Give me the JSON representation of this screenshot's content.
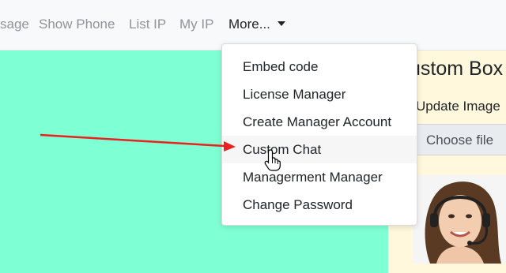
{
  "nav": {
    "items": [
      "sage",
      "Show Phone",
      "List IP",
      "My IP"
    ],
    "more_label": "More..."
  },
  "dropdown": {
    "items": [
      "Embed code",
      "License Manager",
      "Create Manager Account",
      "Custom Chat",
      "Managerment Manager",
      "Change Password"
    ],
    "hovered_item": "Custom Chat"
  },
  "panel": {
    "title": "ustom Box",
    "subtitle": "Update Image",
    "file_button": "Choose file"
  },
  "colors": {
    "content_bg": "#7fffd4",
    "panel_bg": "#fff8dc",
    "arrow": "#e8221f"
  },
  "icons": [
    "caret-down-icon",
    "red-arrow-annotation",
    "hand-pointer-cursor-icon",
    "support-agent-photo"
  ]
}
